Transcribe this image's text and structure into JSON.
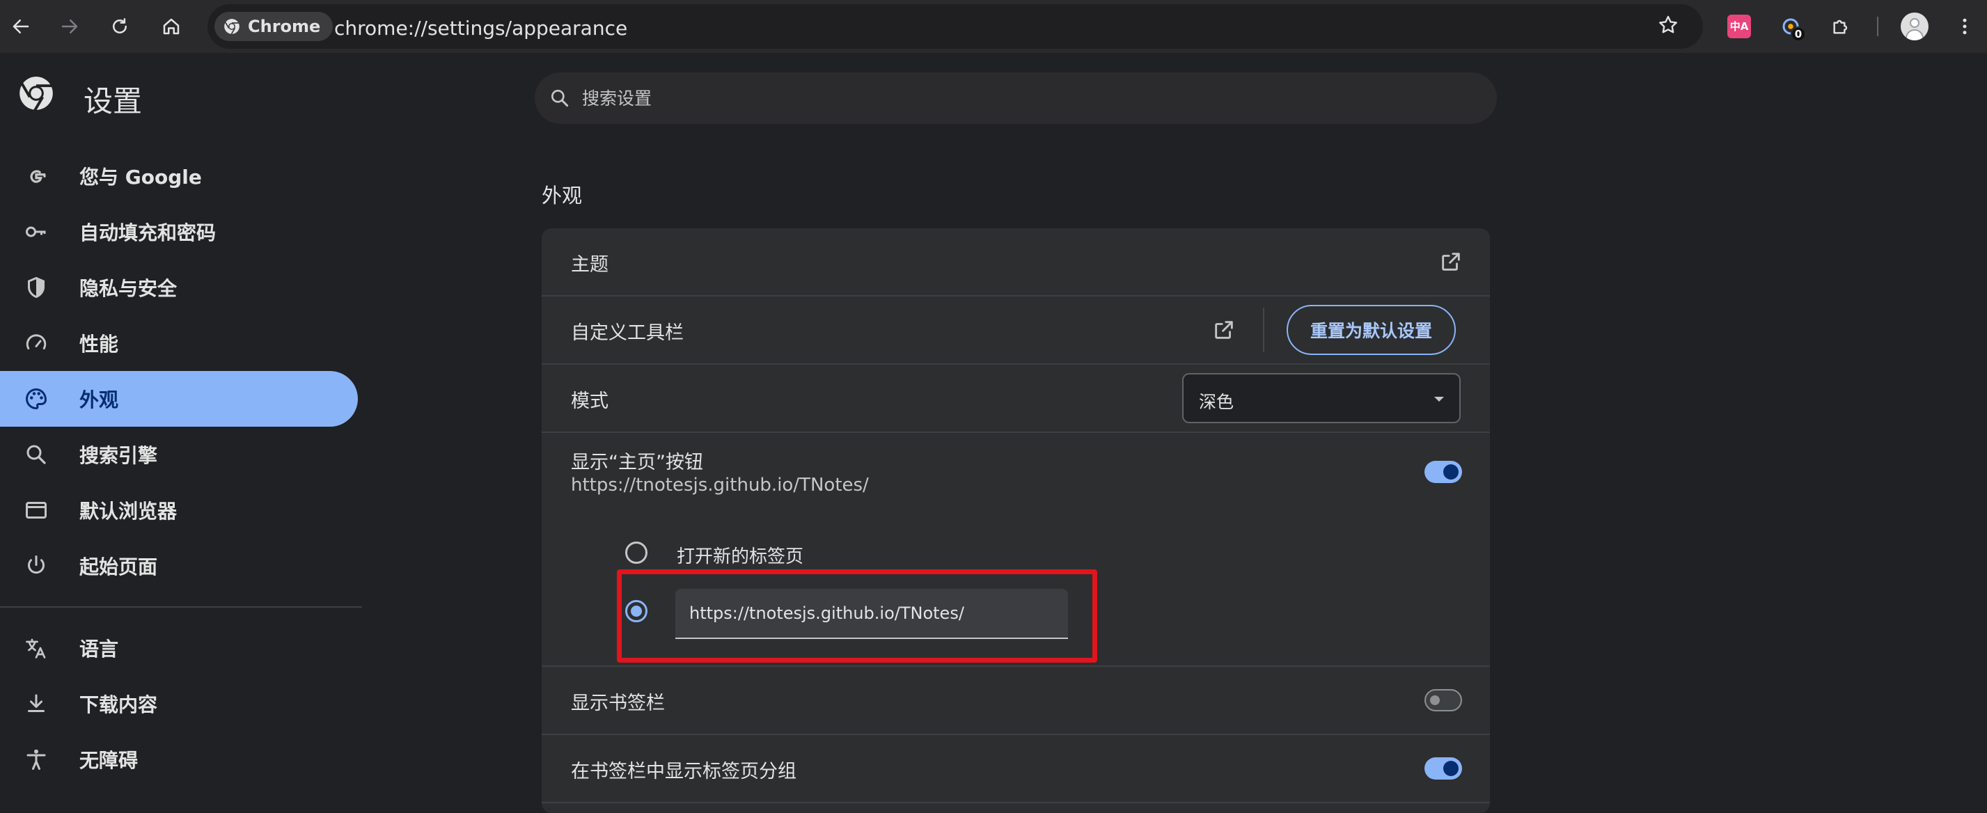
{
  "toolbar": {
    "chip_label": "Chrome",
    "url": "chrome://settings/appearance",
    "extension_badge_count": "0",
    "translate_icon_text": "中A"
  },
  "sidebar": {
    "title": "设置",
    "items": [
      {
        "label": "您与 Google",
        "icon": "google-icon"
      },
      {
        "label": "自动填充和密码",
        "icon": "key-icon"
      },
      {
        "label": "隐私与安全",
        "icon": "shield-icon"
      },
      {
        "label": "性能",
        "icon": "speedometer-icon"
      },
      {
        "label": "外观",
        "icon": "palette-icon",
        "active": true
      },
      {
        "label": "搜索引擎",
        "icon": "search-icon"
      },
      {
        "label": "默认浏览器",
        "icon": "browser-window-icon"
      },
      {
        "label": "起始页面",
        "icon": "power-icon"
      }
    ],
    "items2": [
      {
        "label": "语言",
        "icon": "translate-icon"
      },
      {
        "label": "下载内容",
        "icon": "download-icon"
      },
      {
        "label": "无障碍",
        "icon": "accessibility-icon"
      }
    ]
  },
  "search": {
    "placeholder": "搜索设置"
  },
  "appearance": {
    "section_title": "外观",
    "theme_label": "主题",
    "toolbar_label": "自定义工具栏",
    "reset_button": "重置为默认设置",
    "mode_label": "模式",
    "mode_value": "深色",
    "home_button_label": "显示“主页”按钮",
    "home_button_url": "https://tnotesjs.github.io/TNotes/",
    "home_button_enabled": true,
    "radio_new_tab": "打开新的标签页",
    "custom_url_value": "https://tnotesjs.github.io/TNotes/",
    "bookmarks_bar_label": "显示书签栏",
    "bookmarks_bar_enabled": false,
    "tab_groups_label": "在书签栏中显示标签页分组",
    "tab_groups_enabled": true
  },
  "colors": {
    "accent": "#8ab4f8",
    "highlight": "#e0151e",
    "background": "#202124",
    "card": "#2d2e30"
  }
}
